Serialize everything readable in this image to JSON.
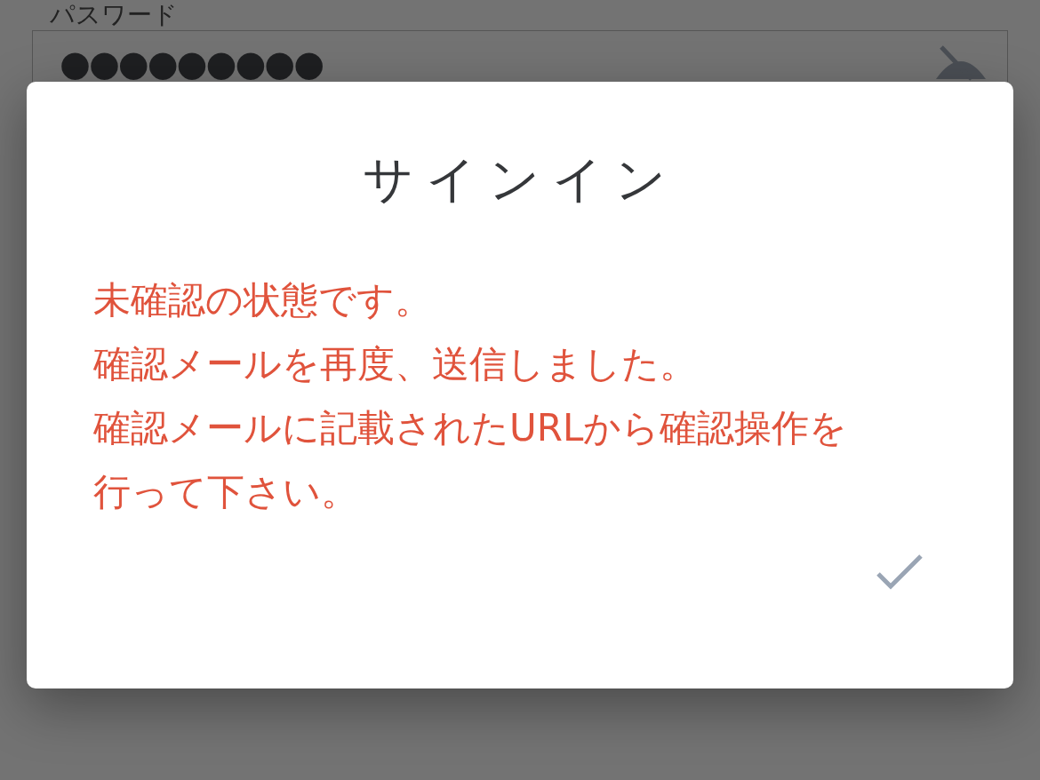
{
  "background": {
    "label": "パスワード",
    "password_field": {
      "value": "●●●●●●●●●"
    }
  },
  "dialog": {
    "title": "サインイン",
    "message_lines": [
      "未確認の状態です。",
      "確認メールを再度、送信しました。",
      "確認メールに記載されたURLから確認操作を",
      "行って下さい。"
    ]
  }
}
